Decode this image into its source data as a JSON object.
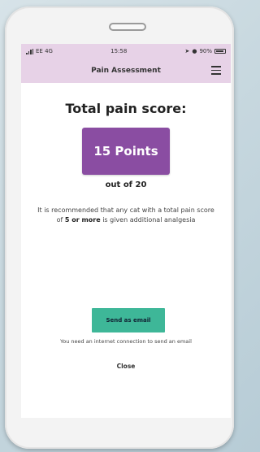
{
  "status": {
    "carrier": "EE 4G",
    "time": "15:58",
    "battery": "90%"
  },
  "appbar": {
    "title": "Pain Assessment",
    "menu_icon": "hamburger-menu-icon"
  },
  "result": {
    "heading": "Total pain score:",
    "score": "15 Points",
    "out_of": "out of 20",
    "recommendation_part1": "It is recommended that any cat with a total pain score of ",
    "recommendation_bold": "5 or more",
    "recommendation_part2": " is given additional analgesia"
  },
  "actions": {
    "email_label": "Send as email",
    "email_note": "You need an internet connection to send an email",
    "close_label": "Close"
  },
  "colors": {
    "header": "#e7d2e7",
    "score_box": "#8a4da2",
    "email_button": "#3eb798"
  }
}
